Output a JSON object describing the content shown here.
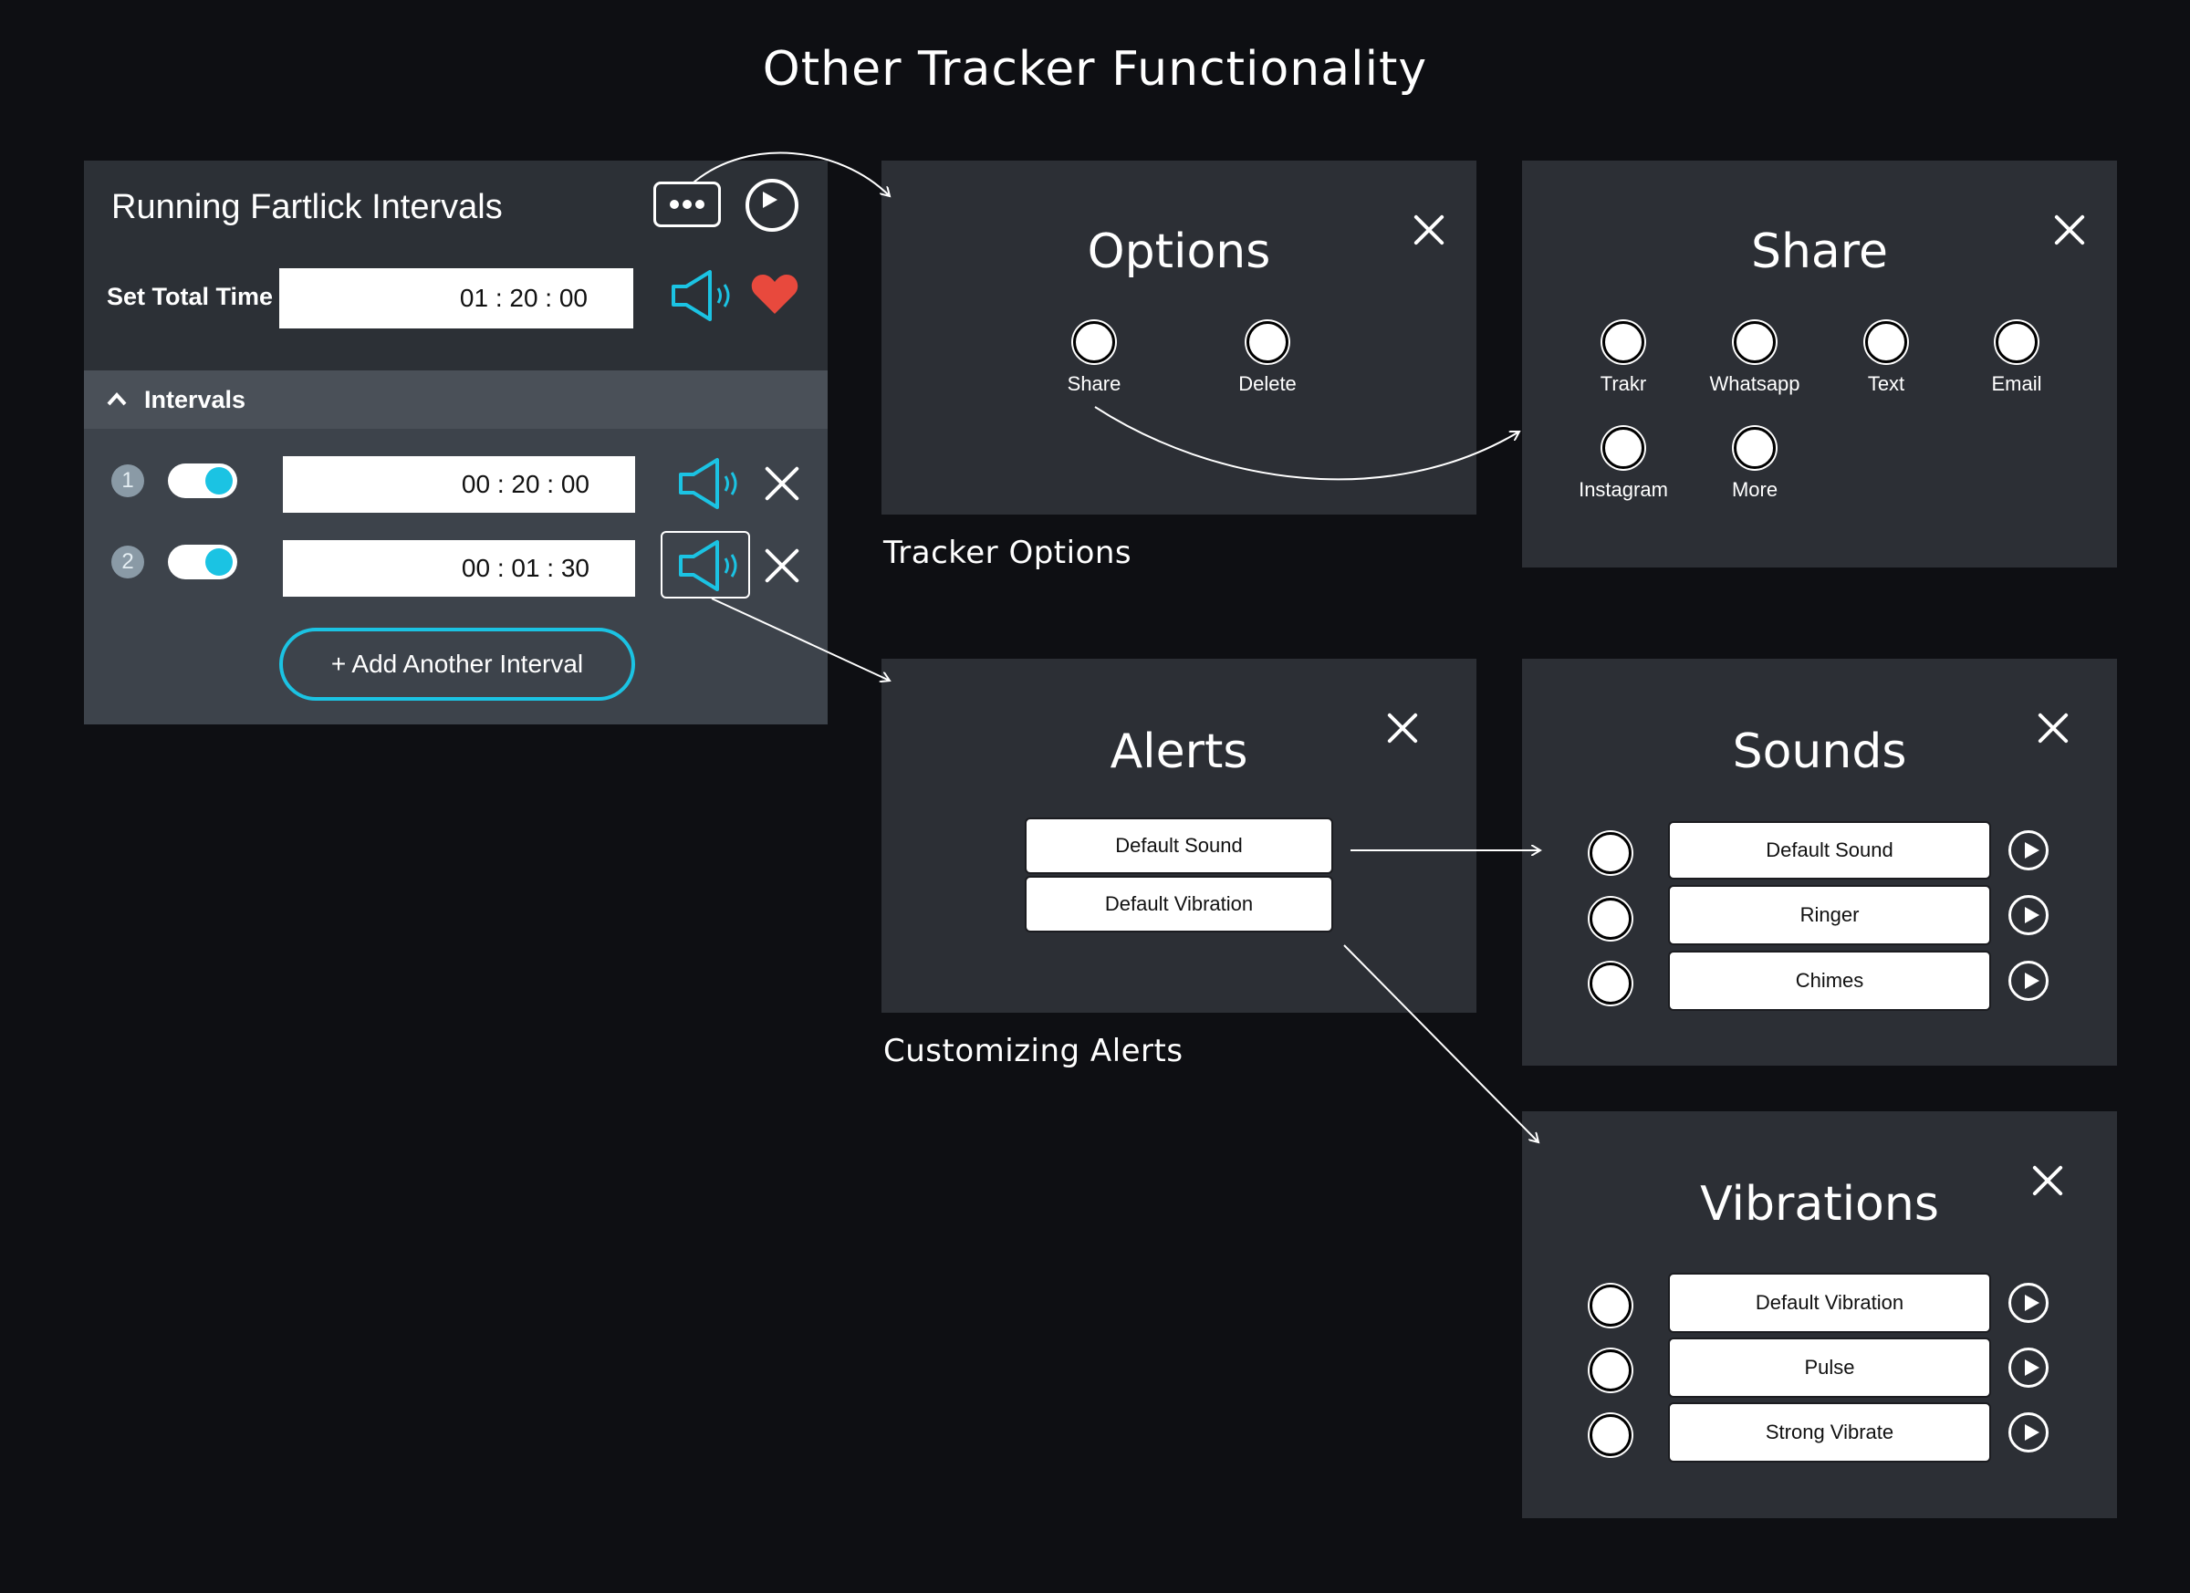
{
  "page_title": "Other Tracker Functionality",
  "tracker": {
    "title": "Running Fartlick Intervals",
    "set_total_time_label": "Set Total Time",
    "total_time": "01 : 20 : 00",
    "intervals_label": "Intervals",
    "intervals": [
      {
        "number": "1",
        "time": "00 : 20 : 00"
      },
      {
        "number": "2",
        "time": "00 : 01 : 30"
      }
    ],
    "add_interval_label": "+ Add Another Interval",
    "colors": {
      "accent": "#1bc3e3",
      "heart": "#e8493d"
    }
  },
  "options": {
    "title": "Options",
    "items": [
      "Share",
      "Delete"
    ],
    "caption": "Tracker Options"
  },
  "share": {
    "title": "Share",
    "items": [
      "Trakr",
      "Whatsapp",
      "Text",
      "Email",
      "Instagram",
      "More"
    ]
  },
  "alerts": {
    "title": "Alerts",
    "items": [
      "Default Sound",
      "Default Vibration"
    ],
    "caption": "Customizing Alerts"
  },
  "sounds": {
    "title": "Sounds",
    "items": [
      "Default Sound",
      "Ringer",
      "Chimes"
    ]
  },
  "vibrations": {
    "title": "Vibrations",
    "items": [
      "Default Vibration",
      "Pulse",
      "Strong Vibrate"
    ]
  }
}
